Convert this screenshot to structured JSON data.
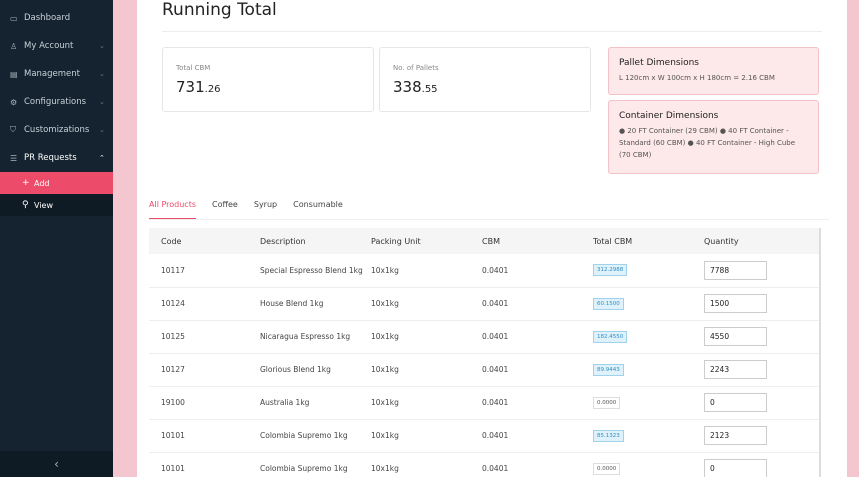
{
  "sidebar": {
    "items": [
      {
        "label": "Dashboard",
        "icon": "dashboard-icon",
        "glyph": "▭",
        "chevron": ""
      },
      {
        "label": "My Account",
        "icon": "user-icon",
        "glyph": "♙",
        "chevron": "⌄"
      },
      {
        "label": "Management",
        "icon": "clipboard-icon",
        "glyph": "▤",
        "chevron": "⌄"
      },
      {
        "label": "Configurations",
        "icon": "gear-icon",
        "glyph": "⚙",
        "chevron": "⌄"
      },
      {
        "label": "Customizations",
        "icon": "cart-icon",
        "glyph": "⛉",
        "chevron": "⌄"
      },
      {
        "label": "PR Requests",
        "icon": "list-icon",
        "glyph": "☰",
        "chevron": "⌃"
      }
    ],
    "sub_items": [
      {
        "label": "Add",
        "glyph": "+"
      },
      {
        "label": "View",
        "glyph": "⚲"
      }
    ],
    "collapse_glyph": "‹"
  },
  "page": {
    "title": "Running Total"
  },
  "stats": {
    "total_cbm": {
      "caption": "Total CBM",
      "int": "731",
      "dec": ".26"
    },
    "pallets": {
      "caption": "No. of Pallets",
      "int": "338",
      "dec": ".55"
    }
  },
  "pallet_dims": {
    "heading": "Pallet Dimensions",
    "text": "L 120cm x W 100cm x H 180cm = 2.16 CBM"
  },
  "container_dims": {
    "heading": "Container Dimensions",
    "text": "● 20 FT Container (29 CBM) ● 40 FT Container - Standard (60 CBM) ● 40 FT Container - High Cube (70 CBM)"
  },
  "tabs": [
    "All Products",
    "Coffee",
    "Syrup",
    "Consumable"
  ],
  "table": {
    "headers": [
      "Code",
      "Description",
      "Packing Unit",
      "CBM",
      "Total CBM",
      "Quantity"
    ],
    "rows": [
      {
        "code": "10117",
        "desc": "Special Espresso Blend 1kg",
        "unit": "10x1kg",
        "cbm": "0.0401",
        "total": "312.2988",
        "qty": "7788"
      },
      {
        "code": "10124",
        "desc": "House Blend 1kg",
        "unit": "10x1kg",
        "cbm": "0.0401",
        "total": "60.1500",
        "qty": "1500"
      },
      {
        "code": "10125",
        "desc": "Nicaragua Espresso 1kg",
        "unit": "10x1kg",
        "cbm": "0.0401",
        "total": "182.4550",
        "qty": "4550"
      },
      {
        "code": "10127",
        "desc": "Glorious Blend 1kg",
        "unit": "10x1kg",
        "cbm": "0.0401",
        "total": "89.9443",
        "qty": "2243"
      },
      {
        "code": "19100",
        "desc": "Australia 1kg",
        "unit": "10x1kg",
        "cbm": "0.0401",
        "total": "0.0000",
        "qty": "0"
      },
      {
        "code": "10101",
        "desc": "Colombia Supremo 1kg",
        "unit": "10x1kg",
        "cbm": "0.0401",
        "total": "85.1323",
        "qty": "2123"
      },
      {
        "code": "10101",
        "desc": "Colombia Supremo 1kg",
        "unit": "10x1kg",
        "cbm": "0.0401",
        "total": "0.0000",
        "qty": "0"
      }
    ]
  },
  "colors": {
    "accent": "#ec4c6a",
    "sidebar": "#14232f",
    "background": "#f4c6cf"
  }
}
